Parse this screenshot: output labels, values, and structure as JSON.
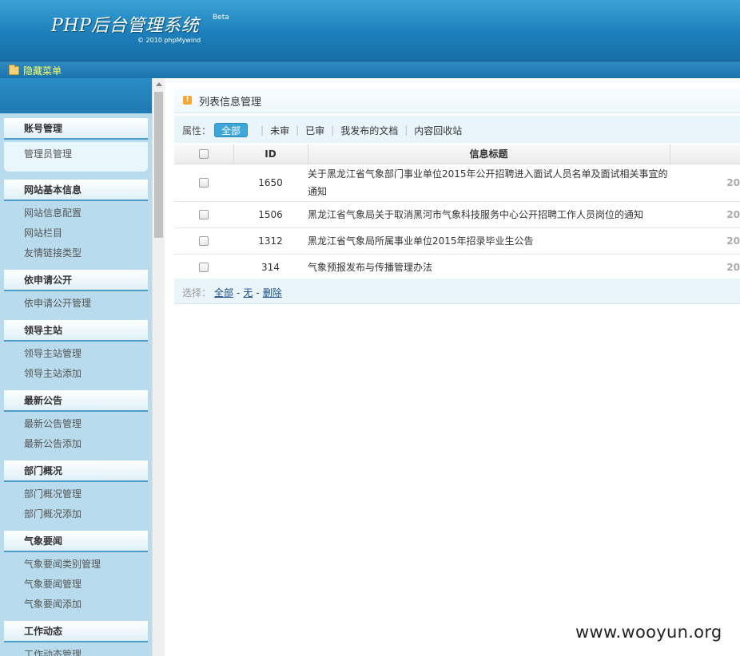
{
  "header": {
    "title": "PHP后台管理系统",
    "beta": "Beta",
    "copyright": "© 2010 phpMywind"
  },
  "menubar": {
    "hide_menu": "隐藏菜单",
    "icon": "folder-icon"
  },
  "sidebar": {
    "groups": [
      {
        "title": "账号管理",
        "items": [
          "管理员管理"
        ]
      },
      {
        "title": "网站基本信息",
        "items": [
          "网站信息配置",
          "网站栏目",
          "友情链接类型"
        ]
      },
      {
        "title": "依申请公开",
        "items": [
          "依申请公开管理"
        ]
      },
      {
        "title": "领导主站",
        "items": [
          "领导主站管理",
          "领导主站添加"
        ]
      },
      {
        "title": "最新公告",
        "items": [
          "最新公告管理",
          "最新公告添加"
        ]
      },
      {
        "title": "部门概况",
        "items": [
          "部门概况管理",
          "部门概况添加"
        ]
      },
      {
        "title": "气象要闻",
        "items": [
          "气象要闻类别管理",
          "气象要闻管理",
          "气象要闻添加"
        ]
      },
      {
        "title": "工作动态",
        "items": [
          "工作动态管理"
        ]
      }
    ]
  },
  "main": {
    "panel_title": "列表信息管理",
    "filter": {
      "label": "属性：",
      "active": "全部",
      "links": [
        "未审",
        "已审",
        "我发布的文档",
        "内容回收站"
      ]
    },
    "table": {
      "headers": {
        "id": "ID",
        "title": "信息标题"
      },
      "rows": [
        {
          "id": "1650",
          "title_line1": "关于黑龙江省气象部门事业单位2015年公开招聘进入面试人员名单及面试相关事宜的",
          "title_line2": "通知",
          "date": "20"
        },
        {
          "id": "1506",
          "title_line1": "黑龙江省气象局关于取消黑河市气象科技服务中心公开招聘工作人员岗位的通知",
          "title_line2": "",
          "date": "20"
        },
        {
          "id": "1312",
          "title_line1": "黑龙江省气象局所属事业单位2015年招录毕业生公告",
          "title_line2": "",
          "date": "20"
        },
        {
          "id": "314",
          "title_line1": "气象预报发布与传播管理办法",
          "title_line2": "",
          "date": "20"
        }
      ]
    },
    "select_bar": {
      "label": "选择：",
      "all": "全部",
      "none": "无",
      "delete": "删除",
      "sep": "-"
    }
  },
  "watermark": "www.wooyun.org"
}
